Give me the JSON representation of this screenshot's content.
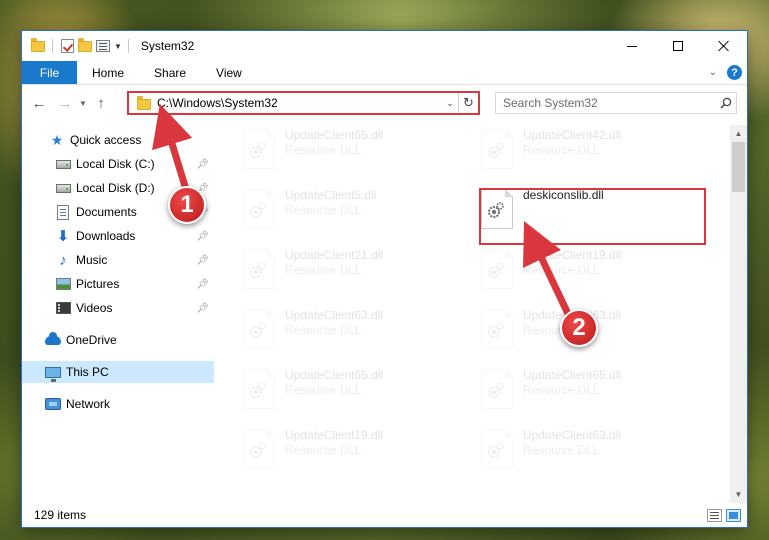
{
  "window": {
    "title": "System32"
  },
  "ribbon": {
    "tabs": [
      "File",
      "Home",
      "Share",
      "View"
    ]
  },
  "address": {
    "path": "C:\\Windows\\System32"
  },
  "search": {
    "placeholder": "Search System32"
  },
  "nav_pane": {
    "items": [
      {
        "label": "Quick access",
        "icon": "star-icon",
        "pinned": false
      },
      {
        "label": "Local Disk (C:)",
        "icon": "drive-icon",
        "pinned": true
      },
      {
        "label": "Local Disk (D:)",
        "icon": "drive-icon",
        "pinned": true
      },
      {
        "label": "Documents",
        "icon": "documents-icon",
        "pinned": true
      },
      {
        "label": "Downloads",
        "icon": "download-arrow-icon",
        "pinned": true
      },
      {
        "label": "Music",
        "icon": "music-note-icon",
        "pinned": true
      },
      {
        "label": "Pictures",
        "icon": "picture-icon",
        "pinned": true
      },
      {
        "label": "Videos",
        "icon": "video-icon",
        "pinned": true
      },
      {
        "label": "OneDrive",
        "icon": "cloud-icon",
        "pinned": false
      },
      {
        "label": "This PC",
        "icon": "computer-icon",
        "pinned": false,
        "selected": true
      },
      {
        "label": "Network",
        "icon": "network-icon",
        "pinned": false
      }
    ]
  },
  "files": {
    "left_column": [
      {
        "name": "UpdateClient65.dll",
        "type": "Resource DLL"
      },
      {
        "name": "UpdateClient5.dll",
        "type": "Resource DLL"
      },
      {
        "name": "UpdateClient21.dll",
        "type": "Resource DLL"
      },
      {
        "name": "UpdateClient63.dll",
        "type": "Resource DLL"
      },
      {
        "name": "UpdateClient65.dll",
        "type": "Resource DLL"
      },
      {
        "name": "UpdateClient19.dll",
        "type": "Resource DLL"
      }
    ],
    "right_column": [
      {
        "name": "UpdateClient42.dll",
        "type": "Resource DLL"
      },
      {
        "name": "deskiconslib.dll",
        "type": "",
        "highlighted": true
      },
      {
        "name": "UpdateClient19.dll",
        "type": "Resource DLL"
      },
      {
        "name": "UpdateClient63.dll",
        "type": "Resource DLL"
      },
      {
        "name": "UpdateClient65.dll",
        "type": "Resource DLL"
      },
      {
        "name": "UpdateClient63.dll",
        "type": "Resource DLL"
      }
    ]
  },
  "status": {
    "item_count": "129 items"
  },
  "annotations": {
    "step1": "1",
    "step2": "2",
    "color": "#d9363e"
  }
}
